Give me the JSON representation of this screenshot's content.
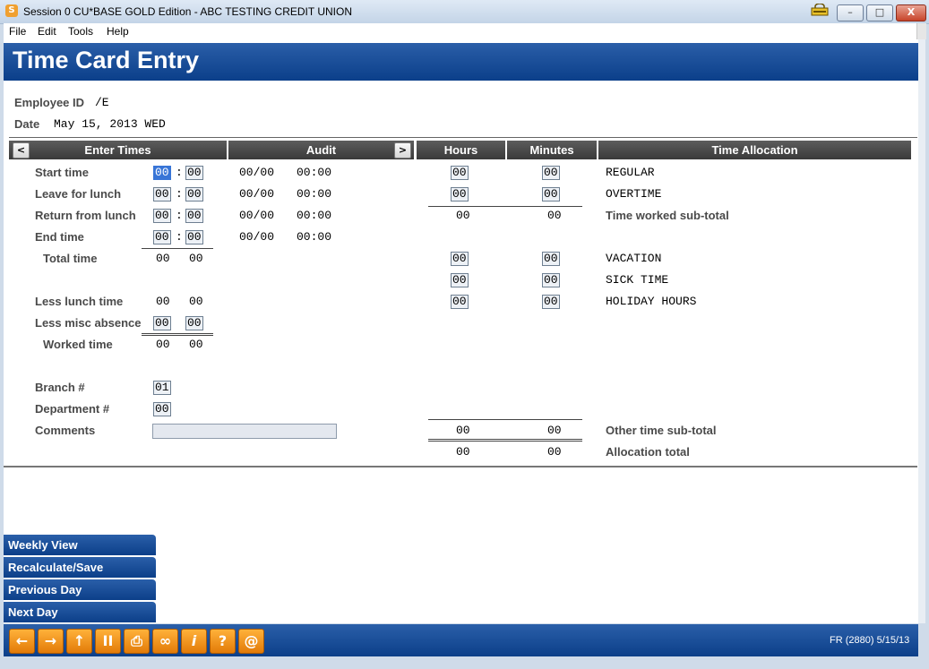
{
  "window": {
    "title": "Session 0 CU*BASE GOLD Edition - ABC TESTING CREDIT UNION",
    "app_icon": "app-icon",
    "min": "–",
    "max": "□",
    "close": "X"
  },
  "menu": [
    "File",
    "Edit",
    "Tools",
    "Help"
  ],
  "page": {
    "title": "Time Card Entry"
  },
  "employee": {
    "label": "Employee ID",
    "value": "/E"
  },
  "date": {
    "label": "Date",
    "value": "May 15, 2013 WED"
  },
  "headers": {
    "enter_times": "Enter Times",
    "audit": "Audit",
    "hours": "Hours",
    "minutes": "Minutes",
    "time_allocation": "Time Allocation",
    "prev": "<",
    "next": ">"
  },
  "times": [
    {
      "label": "Start time",
      "h": "00",
      "m": "00",
      "audit_date": "00/00",
      "audit_time": "00:00"
    },
    {
      "label": "Leave for lunch",
      "h": "00",
      "m": "00",
      "audit_date": "00/00",
      "audit_time": "00:00"
    },
    {
      "label": "Return from lunch",
      "h": "00",
      "m": "00",
      "audit_date": "00/00",
      "audit_time": "00:00"
    },
    {
      "label": "End time",
      "h": "00",
      "m": "00",
      "audit_date": "00/00",
      "audit_time": "00:00"
    }
  ],
  "colon": ":",
  "total_time": {
    "label": "Total time",
    "h": "00",
    "m": "00"
  },
  "less_lunch": {
    "label": "Less lunch time",
    "h": "00",
    "m": "00"
  },
  "less_misc": {
    "label": "Less misc absence",
    "h": "00",
    "m": "00"
  },
  "worked_time": {
    "label": "Worked time",
    "h": "00",
    "m": "00"
  },
  "branch": {
    "label": "Branch #",
    "value": "01"
  },
  "department": {
    "label": "Department #",
    "value": "00"
  },
  "comments": {
    "label": "Comments",
    "value": ""
  },
  "allocation": [
    {
      "label": "REGULAR",
      "h": "00",
      "m": "00"
    },
    {
      "label": "OVERTIME",
      "h": "00",
      "m": "00"
    },
    {
      "label": "VACATION",
      "h": "00",
      "m": "00"
    },
    {
      "label": "SICK TIME",
      "h": "00",
      "m": "00"
    },
    {
      "label": "HOLIDAY HOURS",
      "h": "00",
      "m": "00"
    }
  ],
  "worked_subtotal": {
    "label": "Time worked sub-total",
    "h": "00",
    "m": "00"
  },
  "other_subtotal": {
    "label": "Other time sub-total",
    "h": "00",
    "m": "00"
  },
  "allocation_total": {
    "label": "Allocation total",
    "h": "00",
    "m": "00"
  },
  "side_buttons": [
    "Weekly View",
    "Recalculate/Save",
    "Previous Day",
    "Next Day"
  ],
  "toolbar": [
    {
      "icon": "back-arrow-icon",
      "glyph": "←"
    },
    {
      "icon": "forward-arrow-icon",
      "glyph": "→"
    },
    {
      "icon": "up-arrow-icon",
      "glyph": "↑"
    },
    {
      "icon": "pause-icon",
      "glyph": "II"
    },
    {
      "icon": "print-icon",
      "glyph": "⎙"
    },
    {
      "icon": "link-icon",
      "glyph": "∞"
    },
    {
      "icon": "info-icon",
      "glyph": "i"
    },
    {
      "icon": "help-icon",
      "glyph": "?"
    },
    {
      "icon": "email-icon",
      "glyph": "@"
    }
  ],
  "status": {
    "code": "FR (2880) 5/15/13"
  }
}
